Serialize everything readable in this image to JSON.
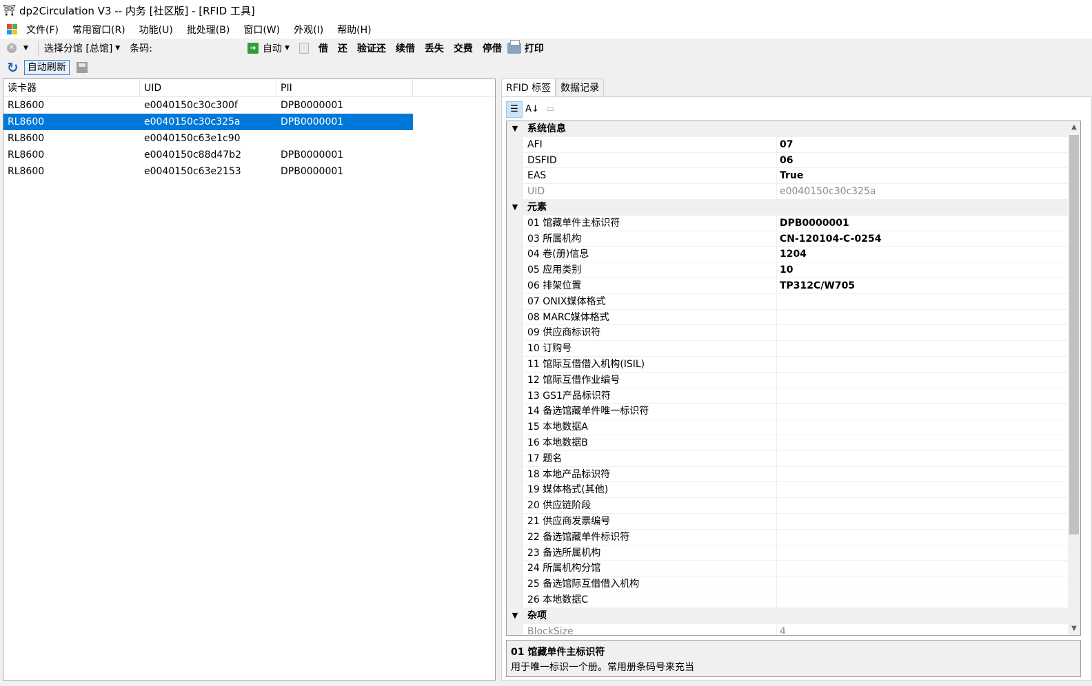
{
  "window": {
    "title": "dp2Circulation V3 -- 内务 [社区版] - [RFID 工具]"
  },
  "menu": [
    "文件(F)",
    "常用窗口(R)",
    "功能(U)",
    "批处理(B)",
    "窗口(W)",
    "外观(I)",
    "帮助(H)"
  ],
  "toolbar": {
    "branch_label": "选择分馆 [总馆]",
    "barcode_label": "条码:",
    "barcode_value": "",
    "auto_label": "自动",
    "actions": [
      "借",
      "还",
      "验证还",
      "续借",
      "丢失",
      "交费",
      "停借"
    ],
    "print_label": "打印",
    "auto_refresh_label": "自动刷新"
  },
  "reader_list": {
    "columns": [
      "读卡器",
      "UID",
      "PII"
    ],
    "rows": [
      {
        "reader": "RL8600",
        "uid": "e0040150c30c300f",
        "pii": "DPB0000001",
        "selected": false
      },
      {
        "reader": "RL8600",
        "uid": "e0040150c30c325a",
        "pii": "DPB0000001",
        "selected": true
      },
      {
        "reader": "RL8600",
        "uid": "e0040150c63e1c90",
        "pii": "",
        "selected": false
      },
      {
        "reader": "RL8600",
        "uid": "e0040150c88d47b2",
        "pii": "DPB0000001",
        "selected": false
      },
      {
        "reader": "RL8600",
        "uid": "e0040150c63e2153",
        "pii": "DPB0000001",
        "selected": false
      }
    ]
  },
  "tabs": [
    "RFID 标签",
    "数据记录"
  ],
  "property_grid": {
    "categories": [
      {
        "name": "系统信息",
        "items": [
          {
            "name": "AFI",
            "value": "07",
            "readonly": false
          },
          {
            "name": "DSFID",
            "value": "06",
            "readonly": false
          },
          {
            "name": "EAS",
            "value": "True",
            "readonly": false
          },
          {
            "name": "UID",
            "value": "e0040150c30c325a",
            "readonly": true
          }
        ]
      },
      {
        "name": "元素",
        "items": [
          {
            "name": "01 馆藏单件主标识符",
            "value": "DPB0000001",
            "readonly": false
          },
          {
            "name": "03 所属机构",
            "value": "CN-120104-C-0254",
            "readonly": false
          },
          {
            "name": "04 卷(册)信息",
            "value": "1204",
            "readonly": false
          },
          {
            "name": "05 应用类别",
            "value": "10",
            "readonly": false
          },
          {
            "name": "06 排架位置",
            "value": "TP312C/W705",
            "readonly": false
          },
          {
            "name": "07 ONIX媒体格式",
            "value": "",
            "readonly": false
          },
          {
            "name": "08 MARC媒体格式",
            "value": "",
            "readonly": false
          },
          {
            "name": "09 供应商标识符",
            "value": "",
            "readonly": false
          },
          {
            "name": "10 订购号",
            "value": "",
            "readonly": false
          },
          {
            "name": "11 馆际互借借入机构(ISIL)",
            "value": "",
            "readonly": false
          },
          {
            "name": "12 馆际互借作业编号",
            "value": "",
            "readonly": false
          },
          {
            "name": "13 GS1产品标识符",
            "value": "",
            "readonly": false
          },
          {
            "name": "14 备选馆藏单件唯一标识符",
            "value": "",
            "readonly": false
          },
          {
            "name": "15 本地数据A",
            "value": "",
            "readonly": false
          },
          {
            "name": "16 本地数据B",
            "value": "",
            "readonly": false
          },
          {
            "name": "17 题名",
            "value": "",
            "readonly": false
          },
          {
            "name": "18 本地产品标识符",
            "value": "",
            "readonly": false
          },
          {
            "name": "19 媒体格式(其他)",
            "value": "",
            "readonly": false
          },
          {
            "name": "20 供应链阶段",
            "value": "",
            "readonly": false
          },
          {
            "name": "21 供应商发票编号",
            "value": "",
            "readonly": false
          },
          {
            "name": "22 备选馆藏单件标识符",
            "value": "",
            "readonly": false
          },
          {
            "name": "23 备选所属机构",
            "value": "",
            "readonly": false
          },
          {
            "name": "24 所属机构分馆",
            "value": "",
            "readonly": false
          },
          {
            "name": "25 备选馆际互借借入机构",
            "value": "",
            "readonly": false
          },
          {
            "name": "26 本地数据C",
            "value": "",
            "readonly": false
          }
        ]
      },
      {
        "name": "杂项",
        "items": [
          {
            "name": "BlockSize",
            "value": "4",
            "readonly": true
          }
        ]
      }
    ],
    "description": {
      "title": "01 馆藏单件主标识符",
      "text": "用于唯一标识一个册。常用册条码号来充当"
    }
  }
}
